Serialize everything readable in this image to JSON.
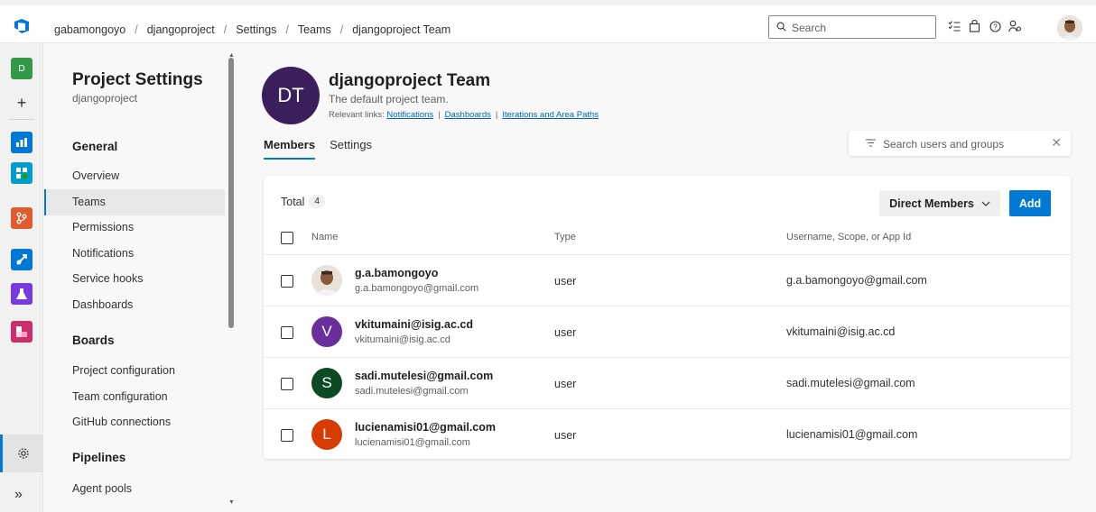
{
  "topbar": {
    "breadcrumb": [
      "gabamongoyo",
      "djangoproject",
      "Settings",
      "Teams",
      "djangoproject Team"
    ],
    "search_placeholder": "Search",
    "icons": [
      "checklist-icon",
      "shopping-bag-icon",
      "help-icon",
      "user-settings-icon"
    ]
  },
  "rail": {
    "project_initial": "D",
    "project_color": "#339947",
    "services": [
      {
        "name": "overview",
        "color": "#0078d4"
      },
      {
        "name": "boards",
        "color": "#009ccc"
      },
      {
        "name": "repos",
        "color": "#e05b2d"
      },
      {
        "name": "pipelines",
        "color": "#0078d4"
      },
      {
        "name": "test-plans",
        "color": "#773adc"
      },
      {
        "name": "artifacts",
        "color": "#cb2e6d"
      }
    ]
  },
  "nav": {
    "title": "Project Settings",
    "subtitle": "djangoproject",
    "sections": {
      "general": "General",
      "boards": "Boards",
      "pipelines": "Pipelines"
    },
    "general_items": [
      "Overview",
      "Teams",
      "Permissions",
      "Notifications",
      "Service hooks",
      "Dashboards"
    ],
    "boards_items": [
      "Project configuration",
      "Team configuration",
      "GitHub connections"
    ],
    "pipelines_items": [
      "Agent pools"
    ],
    "selected": "Teams"
  },
  "team": {
    "initials": "DT",
    "name": "djangoproject Team",
    "description": "The default project team.",
    "links_label": "Relevant links:",
    "links": [
      "Notifications",
      "Dashboards",
      "Iterations and Area Paths"
    ],
    "avatar_color": "#3b1e5c"
  },
  "tabs": [
    "Members",
    "Settings"
  ],
  "filter_placeholder": "Search users and groups",
  "members": {
    "total_label": "Total",
    "total": "4",
    "direct_members_label": "Direct Members",
    "add_label": "Add",
    "columns": [
      "Name",
      "Type",
      "Username, Scope, or App Id"
    ],
    "rows": [
      {
        "display": "g.a.bamongoyo",
        "email": "g.a.bamongoyo@gmail.com",
        "type": "user",
        "id": "g.a.bamongoyo@gmail.com",
        "initial": "",
        "color": "#e9e2da"
      },
      {
        "display": "vkitumaini@isig.ac.cd",
        "email": "vkitumaini@isig.ac.cd",
        "type": "user",
        "id": "vkitumaini@isig.ac.cd",
        "initial": "V",
        "color": "#6a2f9c"
      },
      {
        "display": "sadi.mutelesi@gmail.com",
        "email": "sadi.mutelesi@gmail.com",
        "type": "user",
        "id": "sadi.mutelesi@gmail.com",
        "initial": "S",
        "color": "#0b4a23"
      },
      {
        "display": "lucienamisi01@gmail.com",
        "email": "lucienamisi01@gmail.com",
        "type": "user",
        "id": "lucienamisi01@gmail.com",
        "initial": "L",
        "color": "#d83b01"
      }
    ]
  },
  "accent_color": "#0078d4"
}
